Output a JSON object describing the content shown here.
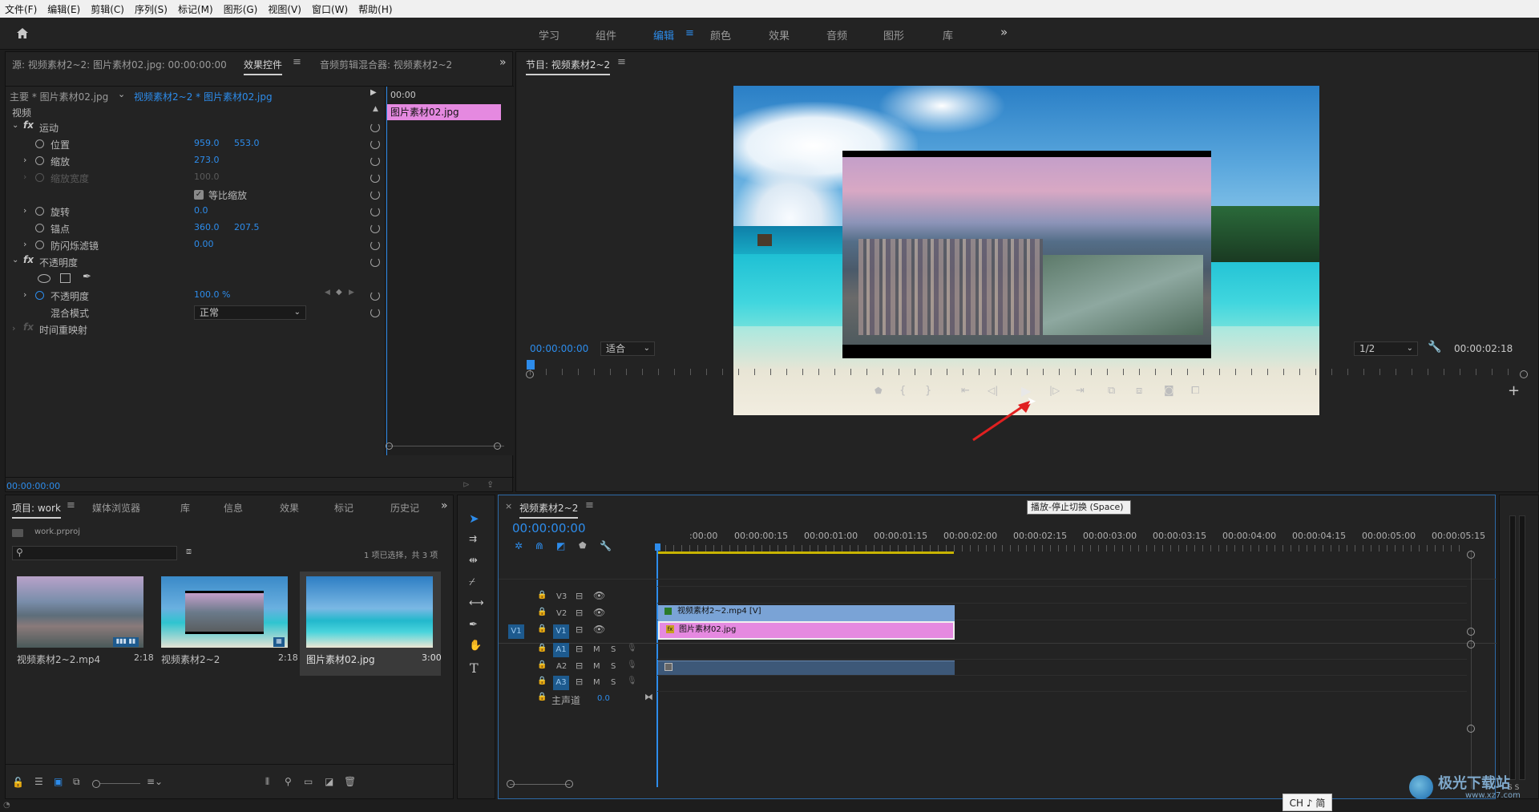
{
  "menu": [
    "文件(F)",
    "编辑(E)",
    "剪辑(C)",
    "序列(S)",
    "标记(M)",
    "图形(G)",
    "视图(V)",
    "窗口(W)",
    "帮助(H)"
  ],
  "workspaces": [
    "学习",
    "组件",
    "编辑",
    "颜色",
    "效果",
    "音频",
    "图形",
    "库"
  ],
  "workspace_active": "编辑",
  "source_panel": {
    "tabs": [
      "源: 视频素材2~2: 图片素材02.jpg: 00:00:00:00",
      "效果控件",
      "音频剪辑混合器: 视频素材2~2"
    ],
    "master": "主要 * 图片素材02.jpg",
    "sequence": "视频素材2~2 * 图片素材02.jpg",
    "ruler_time": "00:00",
    "clip_label": "图片素材02.jpg",
    "section_video": "视频",
    "motion": "运动",
    "position_label": "位置",
    "position_x": "959.0",
    "position_y": "553.0",
    "scale_label": "缩放",
    "scale_value": "273.0",
    "scale_width_label": "缩放宽度",
    "scale_width_value": "100.0",
    "uniform_scale": "等比缩放",
    "rotation_label": "旋转",
    "rotation_value": "0.0",
    "anchor_label": "锚点",
    "anchor_x": "360.0",
    "anchor_y": "207.5",
    "flicker_label": "防闪烁滤镜",
    "flicker_value": "0.00",
    "opacity_section": "不透明度",
    "opacity_label": "不透明度",
    "opacity_value": "100.0 %",
    "blend_label": "混合模式",
    "blend_value": "正常",
    "time_remap": "时间重映射",
    "timecode": "00:00:00:00"
  },
  "program": {
    "title": "节目: 视频素材2~2",
    "timecode": "00:00:00:00",
    "fit": "适合",
    "resolution": "1/2",
    "duration": "00:00:02:18",
    "tooltip": "播放-停止切换 (Space)"
  },
  "project": {
    "tabs": [
      "项目: work",
      "媒体浏览器",
      "库",
      "信息",
      "效果",
      "标记",
      "历史记"
    ],
    "file": "work.prproj",
    "selection": "1 项已选择，共 3 项",
    "items": [
      {
        "name": "视频素材2~2.mp4",
        "duration": "2:18"
      },
      {
        "name": "视频素材2~2",
        "duration": "2:18"
      },
      {
        "name": "图片素材02.jpg",
        "duration": "3:00"
      }
    ]
  },
  "timeline": {
    "title": "视频素材2~2",
    "timecode": "00:00:00:00",
    "ruler": [
      ":00:00",
      "00:00:00:15",
      "00:00:01:00",
      "00:00:01:15",
      "00:00:02:00",
      "00:00:02:15",
      "00:00:03:00",
      "00:00:03:15",
      "00:00:04:00",
      "00:00:04:15",
      "00:00:05:00",
      "00:00:05:15"
    ],
    "tracks": {
      "v3": "V3",
      "v2": "V2",
      "v1": "V1",
      "v1_src": "V1",
      "a1": "A1",
      "a2": "A2",
      "a3": "A3",
      "m": "M",
      "s": "S",
      "master": "主声道",
      "master_value": "0.0"
    },
    "clip_video": "视频素材2~2.mp4 [V]",
    "clip_image": "图片素材02.jpg"
  },
  "meter": {
    "labels": "S S"
  },
  "ime": "CH ♪ 简",
  "watermark": {
    "title": "极光下载站",
    "url": "www.xz7.com"
  }
}
